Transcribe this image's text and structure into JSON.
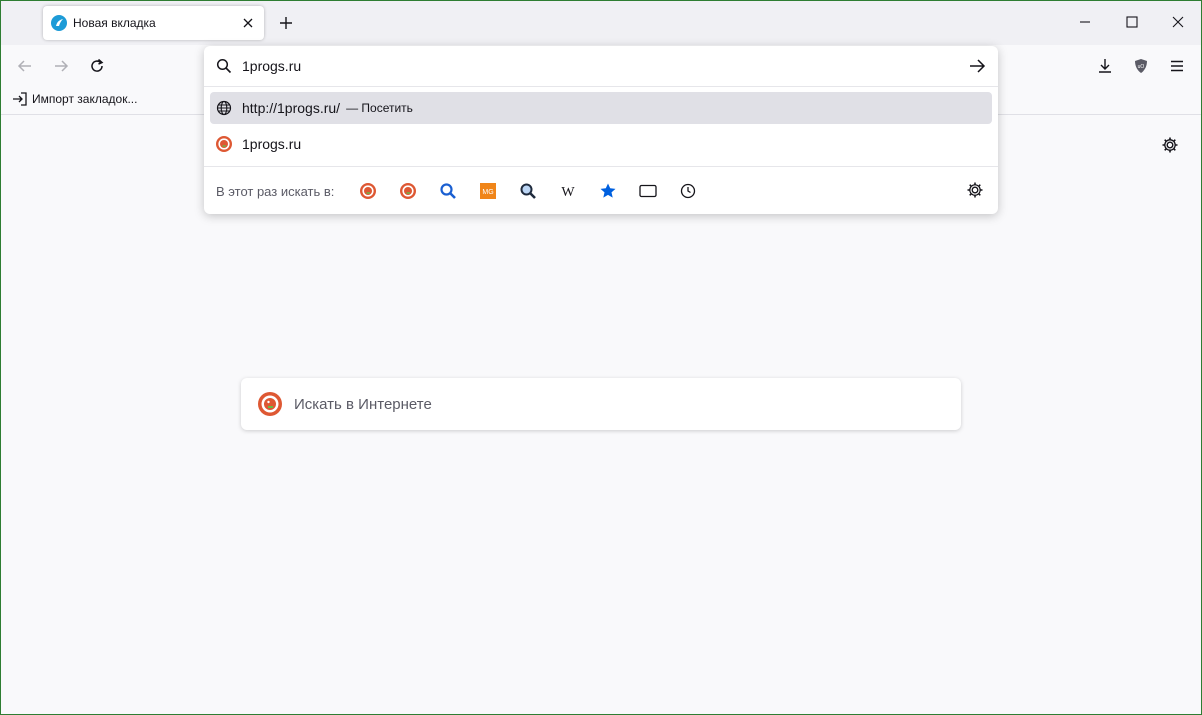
{
  "tab": {
    "title": "Новая вкладка"
  },
  "urlbar": {
    "value": "1progs.ru"
  },
  "suggestions": [
    {
      "url": "http://1progs.ru/",
      "action": "— Посетить"
    },
    {
      "text": "1progs.ru"
    }
  ],
  "engine_bar": {
    "label": "В этот раз искать в:",
    "engines": [
      "duckduckgo-icon",
      "duckduckgo-icon",
      "search-icon",
      "mg-icon",
      "magnifier-icon",
      "wikipedia-icon",
      "bookmarks-star-icon",
      "tabs-icon",
      "history-clock-icon"
    ],
    "mg_text": "MG",
    "wiki_text": "W"
  },
  "bookmarks": {
    "import_label": "Импорт закладок..."
  },
  "content": {
    "search_placeholder": "Искать в Интернете"
  },
  "colors": {
    "accent": "#0060df",
    "selected_row": "#e0e0e6",
    "ddg_orange": "#de5833"
  }
}
